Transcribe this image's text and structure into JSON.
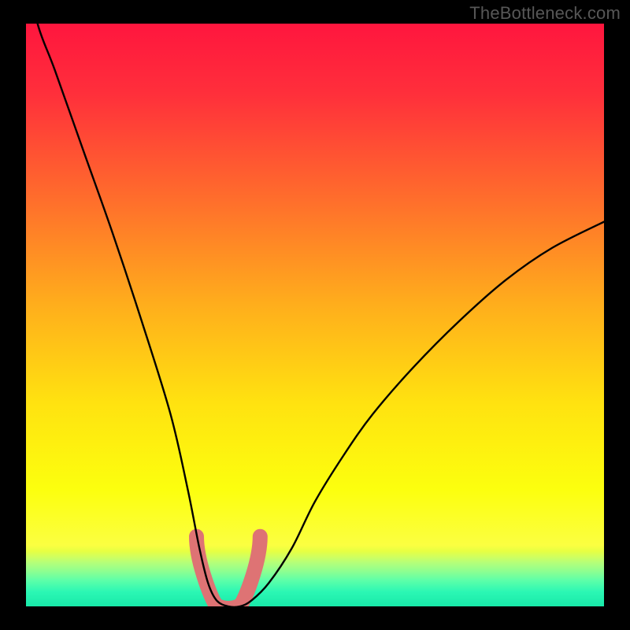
{
  "watermark": "TheBottleneck.com",
  "colors": {
    "frame": "#000000",
    "curve_stroke": "#000000",
    "pink_well": "#de7374",
    "watermark_text": "#575757",
    "gradient_stops": [
      {
        "offset": 0.0,
        "color": "#ff163e"
      },
      {
        "offset": 0.12,
        "color": "#ff2f3b"
      },
      {
        "offset": 0.3,
        "color": "#ff6d2c"
      },
      {
        "offset": 0.48,
        "color": "#ffad1c"
      },
      {
        "offset": 0.65,
        "color": "#ffe210"
      },
      {
        "offset": 0.8,
        "color": "#fcff0e"
      },
      {
        "offset": 0.895,
        "color": "#fbff41"
      },
      {
        "offset": 0.905,
        "color": "#e7ff42"
      },
      {
        "offset": 0.915,
        "color": "#d0ff5f"
      },
      {
        "offset": 0.925,
        "color": "#b4ff79"
      },
      {
        "offset": 0.94,
        "color": "#8dff91"
      },
      {
        "offset": 0.955,
        "color": "#5effa8"
      },
      {
        "offset": 0.975,
        "color": "#2bf7b4"
      },
      {
        "offset": 1.0,
        "color": "#18e9a9"
      }
    ]
  },
  "chart_data": {
    "type": "line",
    "title": "",
    "xlabel": "",
    "ylabel": "",
    "xlim": [
      0,
      100
    ],
    "ylim": [
      0,
      100
    ],
    "x": [
      0,
      2,
      5,
      10,
      15,
      20,
      25,
      28,
      30,
      31.5,
      33,
      35,
      37,
      39,
      42,
      46,
      50,
      55,
      60,
      67,
      75,
      83,
      91,
      100
    ],
    "values": [
      110,
      100,
      92,
      78,
      64,
      49,
      33,
      20,
      10,
      4,
      1,
      0,
      0,
      1,
      4,
      10,
      18,
      26,
      33,
      41,
      49,
      56,
      61.5,
      66
    ],
    "note": "Approximate bottleneck curve; minimum (optimal balance) near x≈35–37 where value≈0. Values are percentages of the plot height (0=bottom/green, 100=top/red).",
    "pink_marker": {
      "description": "salmon U-shaped marker at curve bottom",
      "x_range": [
        29.5,
        40.5
      ],
      "y_range": [
        0,
        12
      ]
    }
  }
}
